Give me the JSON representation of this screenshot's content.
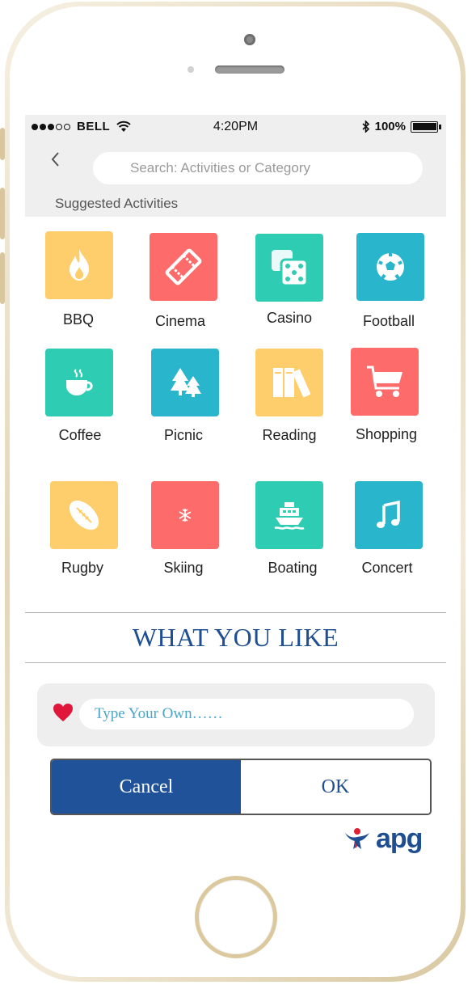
{
  "status_bar": {
    "carrier": "BELL",
    "time": "4:20PM",
    "battery": "100%",
    "signal_dots_filled": 3,
    "signal_dots_total": 5
  },
  "search": {
    "placeholder": "Search:  Activities or Category"
  },
  "section_title": "Suggested Activities",
  "activities": [
    {
      "label": "BBQ",
      "icon": "flame-icon",
      "color": "#fecd6c"
    },
    {
      "label": "Cinema",
      "icon": "ticket-icon",
      "color": "#fd6b6b"
    },
    {
      "label": "Casino",
      "icon": "dice-icon",
      "color": "#2ecdb3"
    },
    {
      "label": "Football",
      "icon": "soccer-ball-icon",
      "color": "#29b5cc"
    },
    {
      "label": "Coffee",
      "icon": "coffee-cup-icon",
      "color": "#2ecdb3"
    },
    {
      "label": "Picnic",
      "icon": "pine-trees-icon",
      "color": "#29b5cc"
    },
    {
      "label": "Reading",
      "icon": "books-icon",
      "color": "#fecd6c"
    },
    {
      "label": "Shopping",
      "icon": "shopping-cart-icon",
      "color": "#fd6b6b"
    },
    {
      "label": "Rugby",
      "icon": "rugby-ball-icon",
      "color": "#fecd6c"
    },
    {
      "label": "Skiing",
      "icon": "snowflake-icon",
      "color": "#fd6b6b"
    },
    {
      "label": "Boating",
      "icon": "boat-icon",
      "color": "#2ecdb3"
    },
    {
      "label": "Concert",
      "icon": "music-note-icon",
      "color": "#29b5cc"
    }
  ],
  "what_you_like": "WHAT YOU LIKE",
  "own_input": {
    "placeholder": "Type Your Own……"
  },
  "buttons": {
    "cancel": "Cancel",
    "ok": "OK"
  },
  "logo": {
    "text": "apg",
    "brand_color": "#1f4f92",
    "accent_color": "#e02033"
  }
}
